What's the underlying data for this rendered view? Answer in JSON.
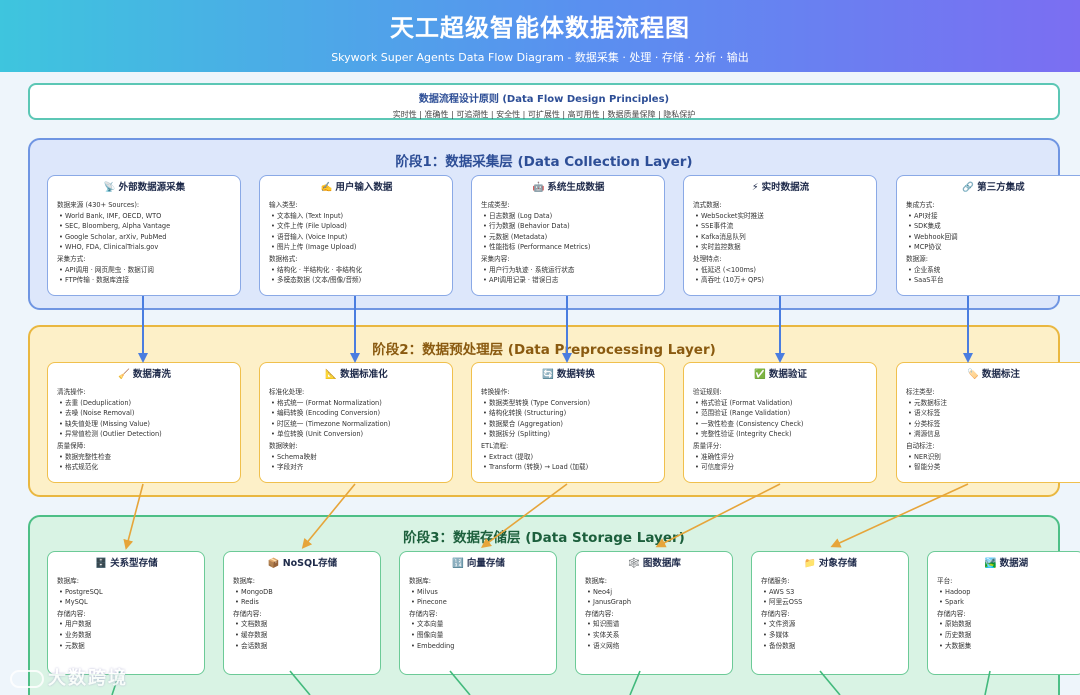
{
  "header": {
    "title": "天工超级智能体数据流程图",
    "subtitle": "Skywork Super Agents Data Flow Diagram - 数据采集 · 处理 · 存储 · 分析 · 输出"
  },
  "principles": {
    "title": "数据流程设计原则 (Data Flow Design Principles)",
    "list": "实时性 | 准确性 | 可追溯性 | 安全性 | 可扩展性 | 高可用性 | 数据质量保障 | 隐私保护"
  },
  "stage1": {
    "title": "阶段1：数据采集层 (Data Collection Layer)",
    "cards": [
      {
        "icon": "📡",
        "title": "外部数据源采集",
        "sections": [
          {
            "label": "数据来源 (430+ Sources):",
            "items": [
              "World Bank, IMF, OECD, WTO",
              "SEC, Bloomberg, Alpha Vantage",
              "Google Scholar, arXiv, PubMed",
              "WHO, FDA, ClinicalTrials.gov"
            ]
          },
          {
            "label": "采集方式:",
            "items": [
              "API调用 · 网页爬虫 · 数据订阅",
              "FTP传输 · 数据库连接"
            ]
          }
        ]
      },
      {
        "icon": "✍️",
        "title": "用户输入数据",
        "sections": [
          {
            "label": "输入类型:",
            "items": [
              "文本输入 (Text Input)",
              "文件上传 (File Upload)",
              "语音输入 (Voice Input)",
              "图片上传 (Image Upload)"
            ]
          },
          {
            "label": "数据格式:",
            "items": [
              "结构化 · 半结构化 · 非结构化",
              "多模态数据 (文本/图像/音频)"
            ]
          }
        ]
      },
      {
        "icon": "🤖",
        "title": "系统生成数据",
        "sections": [
          {
            "label": "生成类型:",
            "items": [
              "日志数据 (Log Data)",
              "行为数据 (Behavior Data)",
              "元数据 (Metadata)",
              "性能指标 (Performance Metrics)"
            ]
          },
          {
            "label": "采集内容:",
            "items": [
              "用户行为轨迹 · 系统运行状态",
              "API调用记录 · 错误日志"
            ]
          }
        ]
      },
      {
        "icon": "⚡",
        "title": "实时数据流",
        "sections": [
          {
            "label": "流式数据:",
            "items": [
              "WebSocket实时推送",
              "SSE事件流",
              "Kafka消息队列",
              "实时监控数据"
            ]
          },
          {
            "label": "处理特点:",
            "items": [
              "低延迟 (<100ms)",
              "高吞吐 (10万+ QPS)"
            ]
          }
        ]
      },
      {
        "icon": "🔗",
        "title": "第三方集成",
        "sections": [
          {
            "label": "集成方式:",
            "items": [
              "API对接",
              "SDK集成",
              "Webhook回调",
              "MCP协议"
            ]
          },
          {
            "label": "数据源:",
            "items": [
              "企业系统",
              "SaaS平台"
            ]
          }
        ]
      }
    ]
  },
  "stage2": {
    "title": "阶段2：数据预处理层 (Data Preprocessing Layer)",
    "cards": [
      {
        "icon": "🧹",
        "title": "数据清洗",
        "sections": [
          {
            "label": "清洗操作:",
            "items": [
              "去重 (Deduplication)",
              "去噪 (Noise Removal)",
              "缺失值处理 (Missing Value)",
              "异常值检测 (Outlier Detection)"
            ]
          },
          {
            "label": "质量保障:",
            "items": [
              "数据完整性检查",
              "格式规范化"
            ]
          }
        ]
      },
      {
        "icon": "📐",
        "title": "数据标准化",
        "sections": [
          {
            "label": "标准化处理:",
            "items": [
              "格式统一 (Format Normalization)",
              "编码转换 (Encoding Conversion)",
              "时区统一 (Timezone Normalization)",
              "单位转换 (Unit Conversion)"
            ]
          },
          {
            "label": "数据映射:",
            "items": [
              "Schema映射",
              "字段对齐"
            ]
          }
        ]
      },
      {
        "icon": "🔄",
        "title": "数据转换",
        "sections": [
          {
            "label": "转换操作:",
            "items": [
              "数据类型转换 (Type Conversion)",
              "结构化转换 (Structuring)",
              "数据聚合 (Aggregation)",
              "数据拆分 (Splitting)"
            ]
          },
          {
            "label": "ETL流程:",
            "items": [
              "Extract (提取)",
              "Transform (转换) → Load (加载)"
            ]
          }
        ]
      },
      {
        "icon": "✅",
        "title": "数据验证",
        "sections": [
          {
            "label": "验证规则:",
            "items": [
              "格式验证 (Format Validation)",
              "范围验证 (Range Validation)",
              "一致性检查 (Consistency Check)",
              "完整性验证 (Integrity Check)"
            ]
          },
          {
            "label": "质量评分:",
            "items": [
              "准确性评分",
              "可信度评分"
            ]
          }
        ]
      },
      {
        "icon": "🏷️",
        "title": "数据标注",
        "sections": [
          {
            "label": "标注类型:",
            "items": [
              "元数据标注",
              "语义标签",
              "分类标签",
              "溯源信息"
            ]
          },
          {
            "label": "自动标注:",
            "items": [
              "NER识别",
              "智能分类"
            ]
          }
        ]
      }
    ]
  },
  "stage3": {
    "title": "阶段3：数据存储层 (Data Storage Layer)",
    "cards": [
      {
        "icon": "🗄️",
        "title": "关系型存储",
        "sections": [
          {
            "label": "数据库:",
            "items": [
              "PostgreSQL",
              "MySQL"
            ]
          },
          {
            "label": "存储内容:",
            "items": [
              "用户数据",
              "业务数据",
              "元数据"
            ]
          }
        ]
      },
      {
        "icon": "📦",
        "title": "NoSQL存储",
        "sections": [
          {
            "label": "数据库:",
            "items": [
              "MongoDB",
              "Redis"
            ]
          },
          {
            "label": "存储内容:",
            "items": [
              "文档数据",
              "缓存数据",
              "会话数据"
            ]
          }
        ]
      },
      {
        "icon": "🔢",
        "title": "向量存储",
        "sections": [
          {
            "label": "数据库:",
            "items": [
              "Milvus",
              "Pinecone"
            ]
          },
          {
            "label": "存储内容:",
            "items": [
              "文本向量",
              "图像向量",
              "Embedding"
            ]
          }
        ]
      },
      {
        "icon": "🕸️",
        "title": "图数据库",
        "sections": [
          {
            "label": "数据库:",
            "items": [
              "Neo4j",
              "JanusGraph"
            ]
          },
          {
            "label": "存储内容:",
            "items": [
              "知识图谱",
              "实体关系",
              "语义网络"
            ]
          }
        ]
      },
      {
        "icon": "📁",
        "title": "对象存储",
        "sections": [
          {
            "label": "存储服务:",
            "items": [
              "AWS S3",
              "阿里云OSS"
            ]
          },
          {
            "label": "存储内容:",
            "items": [
              "文件资源",
              "多媒体",
              "备份数据"
            ]
          }
        ]
      },
      {
        "icon": "🏞️",
        "title": "数据湖",
        "sections": [
          {
            "label": "平台:",
            "items": [
              "Hadoop",
              "Spark"
            ]
          },
          {
            "label": "存储内容:",
            "items": [
              "原始数据",
              "历史数据",
              "大数据集"
            ]
          }
        ]
      }
    ]
  },
  "watermark": "大数跨境"
}
